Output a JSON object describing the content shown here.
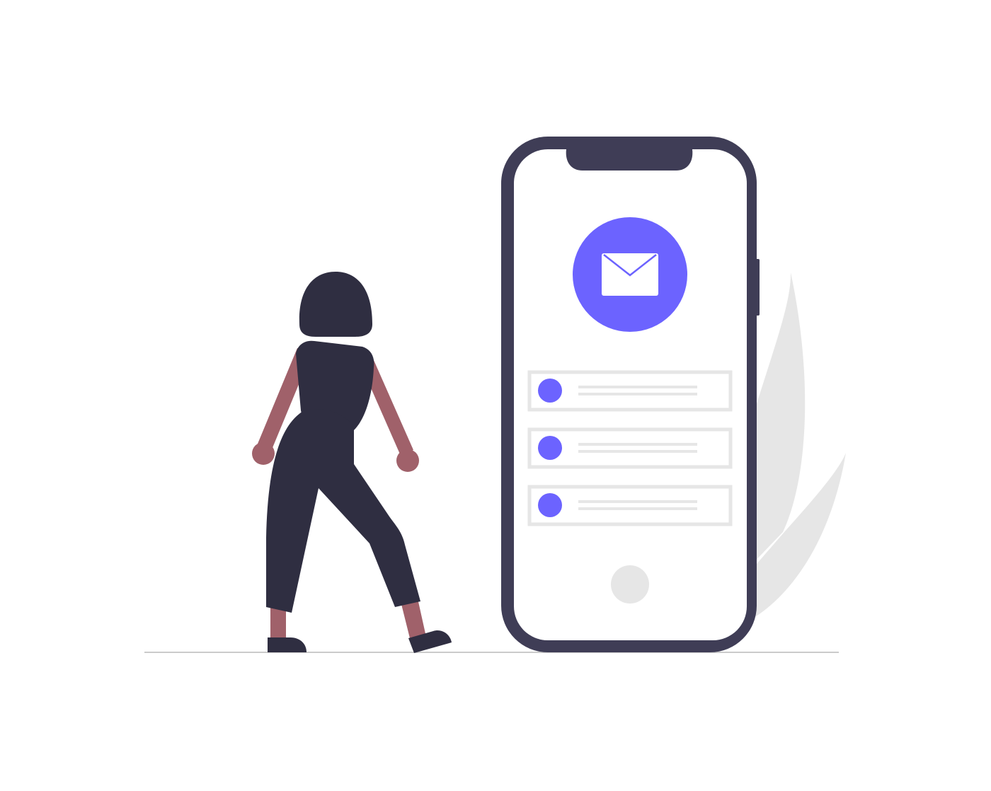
{
  "illustration": {
    "description_visible_text": "",
    "phone": {
      "notification_count": 3
    },
    "icons": {
      "envelope": "envelope-icon",
      "home_button": "home-button-icon",
      "person": "person-figure",
      "plant": "plant-leaves"
    },
    "colors": {
      "accent": "#6c63ff",
      "dark": "#2f2e41",
      "phone_frame": "#3f3d56",
      "skin": "#a0616a",
      "light_gray": "#e6e6e6",
      "ground": "#cbcbcb",
      "screen": "#ffffff"
    }
  }
}
